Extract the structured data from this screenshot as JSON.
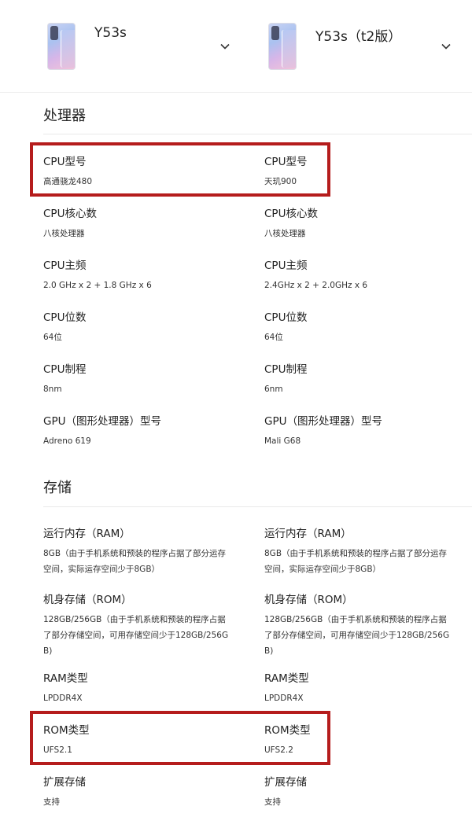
{
  "header": {
    "left_model": "Y53s",
    "right_model": "Y53s（t2版）"
  },
  "sections": {
    "processor": "处理器",
    "storage": "存储"
  },
  "specs": [
    {
      "label": "CPU型号",
      "left": "高通骁龙480",
      "right": "天玑900"
    },
    {
      "label": "CPU核心数",
      "left": "八核处理器",
      "right": "八核处理器"
    },
    {
      "label": "CPU主频",
      "left": "2.0 GHz x 2 + 1.8 GHz x 6",
      "right": "2.4GHz x 2 + 2.0GHz x 6"
    },
    {
      "label": "CPU位数",
      "left": "64位",
      "right": "64位"
    },
    {
      "label": "CPU制程",
      "left": "8nm",
      "right": "6nm"
    },
    {
      "label": "GPU（图形处理器）型号",
      "left": "Adreno 619",
      "right": "Mali G68"
    },
    {
      "label": "运行内存（RAM）",
      "left": "8GB（由于手机系统和预装的程序占据了部分运存空间，实际运存空间少于8GB）",
      "right": "8GB（由于手机系统和预装的程序占据了部分运存空间，实际运存空间少于8GB）"
    },
    {
      "label": "机身存储（ROM）",
      "left": "128GB/256GB（由于手机系统和预装的程序占据了部分存储空间，可用存储空间少于128GB/256GB)",
      "right": "128GB/256GB（由于手机系统和预装的程序占据了部分存储空间，可用存储空间少于128GB/256GB)"
    },
    {
      "label": "RAM类型",
      "left": "LPDDR4X",
      "right": "LPDDR4X"
    },
    {
      "label": "ROM类型",
      "left": "UFS2.1",
      "right": "UFS2.2"
    },
    {
      "label": "扩展存储",
      "left": "支持",
      "right": "支持"
    }
  ],
  "colors": {
    "highlight": "#b51c1c"
  }
}
